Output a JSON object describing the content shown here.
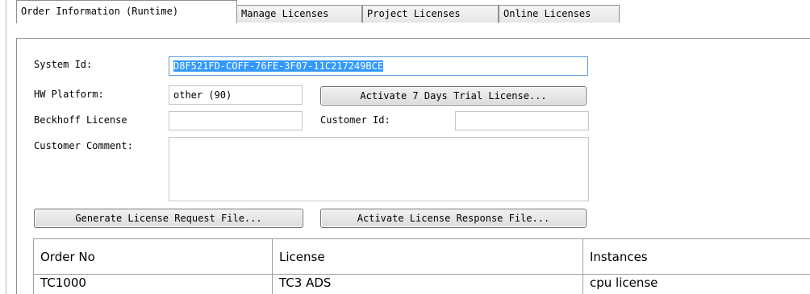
{
  "tabs": [
    {
      "label": "Order Information (Runtime)",
      "active": true
    },
    {
      "label": "Manage Licenses",
      "active": false
    },
    {
      "label": "Project Licenses",
      "active": false
    },
    {
      "label": "Online Licenses",
      "active": false
    }
  ],
  "form": {
    "system_id_label": "System Id:",
    "system_id_value": "D8F521FD-COFF-76FE-3F07-11C217249BCE",
    "hw_platform_label": "HW Platform:",
    "hw_platform_value": "other (90)",
    "beckhoff_license_label": "Beckhoff License",
    "beckhoff_license_value": "",
    "customer_id_label": "Customer Id:",
    "customer_id_value": "",
    "customer_comment_label": "Customer Comment:",
    "customer_comment_value": ""
  },
  "buttons": {
    "trial": "Activate 7 Days Trial License...",
    "generate": "Generate License Request File...",
    "activate_response": "Activate License Response File..."
  },
  "table": {
    "columns": [
      "Order No",
      "License",
      "Instances"
    ],
    "rows": [
      [
        "TC1000",
        "TC3 ADS",
        "cpu license"
      ]
    ]
  },
  "colors": {
    "selection": "#3399ff",
    "focus_border": "#5b9bd5"
  }
}
